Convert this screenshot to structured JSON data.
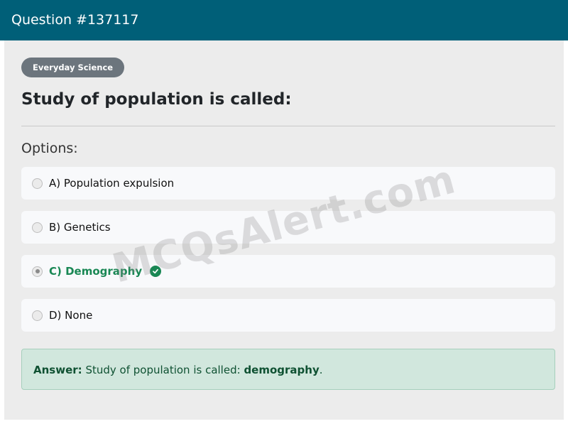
{
  "header": {
    "title": "Question #137117"
  },
  "question": {
    "category": "Everyday Science",
    "text": "Study of population is called:"
  },
  "options_label": "Options:",
  "options": [
    {
      "label": "A) Population expulsion",
      "selected": false,
      "correct": false
    },
    {
      "label": "B) Genetics",
      "selected": false,
      "correct": false
    },
    {
      "label": "C) Demography",
      "selected": true,
      "correct": true
    },
    {
      "label": "D) None",
      "selected": false,
      "correct": false
    }
  ],
  "answer": {
    "prefix": "Answer:",
    "text": "Study of population is called:",
    "highlight": "demography",
    "suffix": "."
  },
  "watermark": "MCQsAlert.com",
  "colors": {
    "header": "#005f78",
    "correct": "#198754",
    "answer_bg": "#d1e7dd",
    "badge": "#6c757d"
  },
  "icons": {
    "correct_option": "check-circle-icon"
  }
}
